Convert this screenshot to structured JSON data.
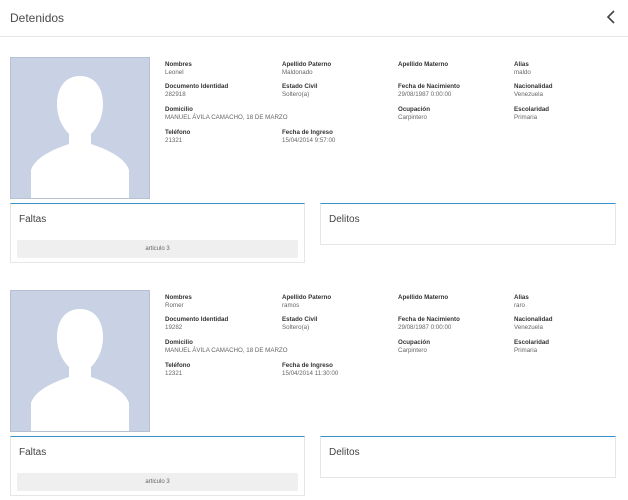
{
  "header": {
    "title": "Detenidos",
    "back_icon": "chevron-left-icon"
  },
  "labels": {
    "nombres": "Nombres",
    "apellido_paterno": "Apellido Paterno",
    "apellido_materno": "Apellido Materno",
    "alias": "Alias",
    "documento": "Documento Identidad",
    "estado_civil": "Estado Civil",
    "fecha_nacimiento": "Fecha de Nacimiento",
    "nacionalidad": "Nacionalidad",
    "domicilio": "Domicilio",
    "ocupacion": "Ocupación",
    "escolaridad": "Escolaridad",
    "telefono": "Teléfono",
    "fecha_ingreso": "Fecha de Ingreso",
    "faltas": "Faltas",
    "delitos": "Delitos"
  },
  "detenidos": [
    {
      "nombres": "Leonel",
      "apellido_paterno": "Maldonado",
      "apellido_materno": "",
      "alias": "maldo",
      "documento": "282918",
      "estado_civil": "Soltero(a)",
      "fecha_nacimiento": "29/08/1987 0:00:00",
      "nacionalidad": "Venezuela",
      "domicilio": "MANUEL ÁVILA CAMACHO, 18 DE MARZO",
      "ocupacion": "Carpintero",
      "escolaridad": "Primaria",
      "telefono": "21321",
      "fecha_ingreso": "15/04/2014 9:57:00",
      "faltas": [
        "articulo 3"
      ],
      "delitos": []
    },
    {
      "nombres": "Romer",
      "apellido_paterno": "ramos",
      "apellido_materno": "",
      "alias": "raro",
      "documento": "19282",
      "estado_civil": "Soltero(a)",
      "fecha_nacimiento": "29/08/1987 0:00:00",
      "nacionalidad": "Venezuela",
      "domicilio": "MANUEL ÁVILA CAMACHO, 18 DE MARZO",
      "ocupacion": "Carpintero",
      "escolaridad": "Primaria",
      "telefono": "12321",
      "fecha_ingreso": "15/04/2014 11:30:00",
      "faltas": [
        "articulo 3"
      ],
      "delitos": []
    }
  ]
}
